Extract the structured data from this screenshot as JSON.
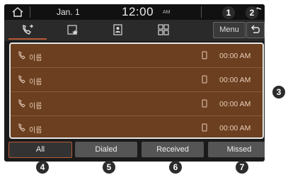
{
  "status": {
    "date": "Jan. 1",
    "time": "12:00",
    "ampm": "AM"
  },
  "toolbar": {
    "menu_label": "Menu"
  },
  "tabs": [
    {
      "icon": "call-history-icon",
      "active": true
    },
    {
      "icon": "favorites-icon",
      "active": false
    },
    {
      "icon": "contacts-icon",
      "active": false
    },
    {
      "icon": "dial-pad-icon",
      "active": false
    }
  ],
  "call_log": [
    {
      "name": "이름",
      "time": "00:00 AM"
    },
    {
      "name": "이름",
      "time": "00:00 AM"
    },
    {
      "name": "이름",
      "time": "00:00 AM"
    },
    {
      "name": "이름",
      "time": "00:00 AM"
    }
  ],
  "filters": [
    {
      "label": "All",
      "active": true
    },
    {
      "label": "Dialed",
      "active": false
    },
    {
      "label": "Received",
      "active": false
    },
    {
      "label": "Missed",
      "active": false
    }
  ],
  "callouts": [
    "1",
    "2",
    "3",
    "4",
    "5",
    "6",
    "7"
  ],
  "colors": {
    "accent": "#b85a35",
    "list_bg": "#6b3f1f"
  }
}
